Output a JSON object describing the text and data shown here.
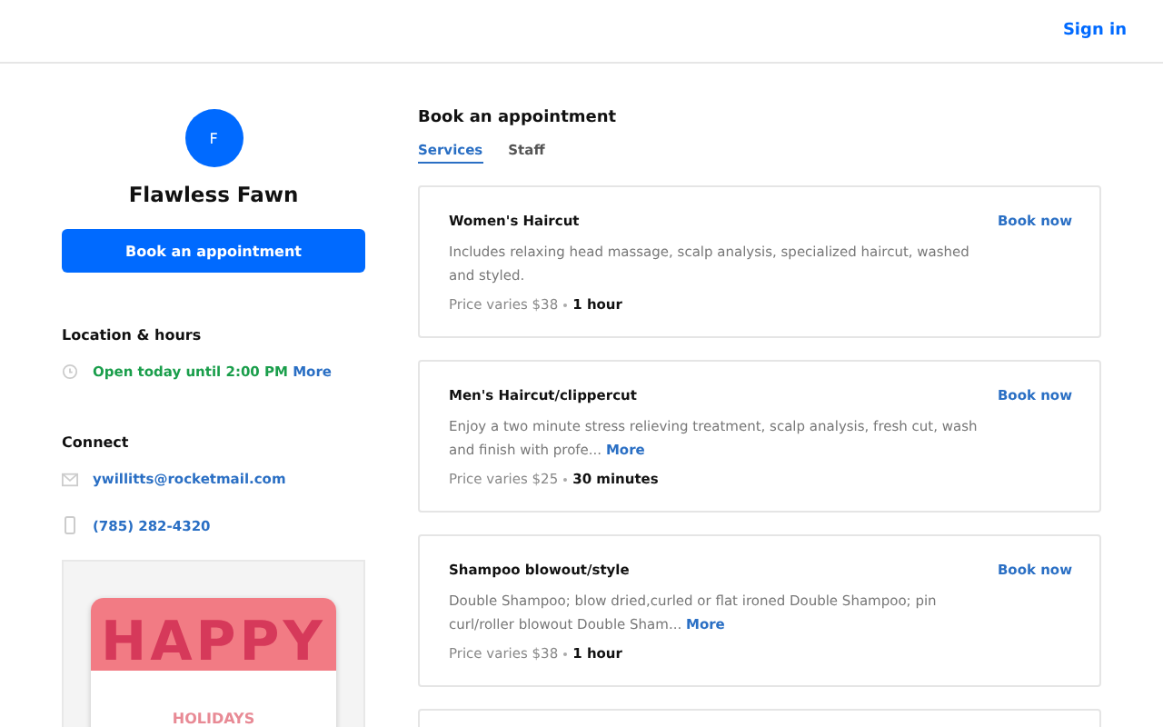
{
  "header": {
    "sign_in": "Sign in"
  },
  "profile": {
    "initial": "F",
    "name": "Flawless Fawn",
    "book_button": "Book an appointment"
  },
  "location": {
    "heading": "Location & hours",
    "status": "Open today until 2:00 PM",
    "more": "More"
  },
  "connect": {
    "heading": "Connect",
    "items": [
      {
        "kind": "email",
        "text": "ywillitts@rocketmail.com"
      },
      {
        "kind": "phone",
        "text": "(785) 282-4320"
      }
    ]
  },
  "gift_card": {
    "line_1": "HAPPY",
    "line_2": "HOLIDAYS"
  },
  "booking": {
    "title": "Book an appointment",
    "tabs": [
      {
        "label": "Services",
        "selected": true
      },
      {
        "label": "Staff",
        "selected": false
      }
    ],
    "services": [
      {
        "name": "Women's Haircut",
        "action": "Book now",
        "description": "Includes relaxing head massage, scalp analysis, specialized haircut, washed and styled.",
        "price": "Price varies $38",
        "duration": "1 hour"
      },
      {
        "name": "Men's Haircut/clippercut",
        "action": "Book now",
        "description": "Enjoy a two minute stress relieving treatment, scalp analysis, fresh cut, wash and finish with profe...",
        "more": "More",
        "price": "Price varies $25",
        "duration": "30 minutes"
      },
      {
        "name": "Shampoo blowout/style",
        "action": "Book now",
        "description": "Double Shampoo; blow dried,curled or flat ironed Double Shampoo; pin curl/roller blowout Double Sham...",
        "more": "More",
        "price": "Price varies $38",
        "duration": "1 hour"
      }
    ]
  }
}
